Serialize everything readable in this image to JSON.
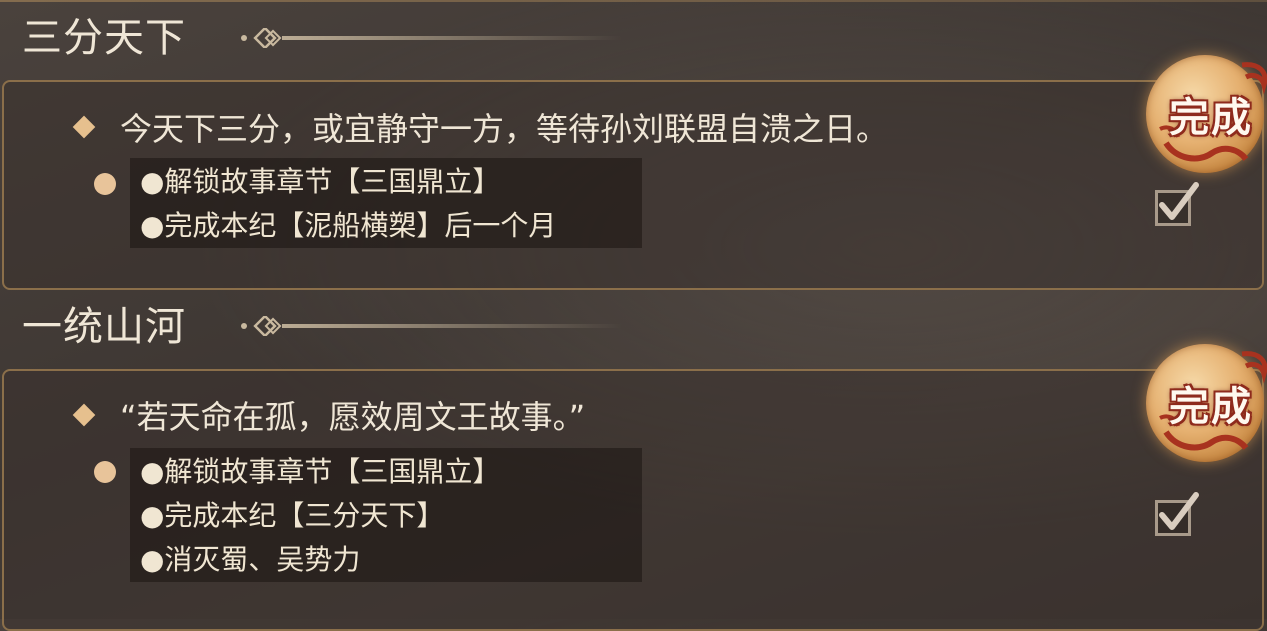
{
  "sections": [
    {
      "title": "三分天下",
      "description": "今天下三分，或宜静守一方，等待孙刘联盟自溃之日。",
      "conditions": [
        "●解锁故事章节【三国鼎立】",
        "●完成本纪【泥船横槊】后一个月"
      ],
      "badge": "完成",
      "checked": true
    },
    {
      "title": "一统山河",
      "description": "“若天命在孤，愿效周文王故事。”",
      "conditions": [
        "●解锁故事章节【三国鼎立】",
        "●完成本纪【三分天下】",
        "●消灭蜀、吴势力"
      ],
      "badge": "完成",
      "checked": true
    }
  ],
  "colors": {
    "accent": "#e6c08e",
    "border": "#8b6f4a",
    "badge_red": "#8e2a1c",
    "background": "#433b36"
  },
  "icons": [
    "diamond-bullet-icon",
    "dot-bullet-icon",
    "ornament-divider-icon",
    "complete-seal-icon",
    "checkmark-icon"
  ]
}
